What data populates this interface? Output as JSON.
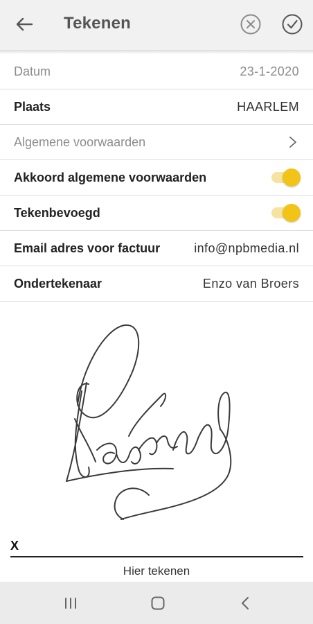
{
  "header": {
    "title": "Tekenen",
    "back_icon": "arrow-left-icon",
    "cancel_icon": "circle-x-icon",
    "confirm_icon": "circle-check-icon"
  },
  "form": {
    "rows": [
      {
        "label": "Datum",
        "value": "23-1-2020"
      },
      {
        "label": "Plaats",
        "value": "HAARLEM"
      },
      {
        "label": "Algemene voorwaarden",
        "value": ">"
      },
      {
        "label": "Akkoord algemene voorwaarden",
        "toggle_on": true
      },
      {
        "label": "Tekenbevoegd",
        "toggle_on": true
      },
      {
        "label": "Email adres voor factuur",
        "value": "info@npbmedia.nl"
      },
      {
        "label": "Ondertekenaar",
        "value": "Enzo van Broers"
      }
    ]
  },
  "signature": {
    "x_mark": "X",
    "hint": "Hier tekenen"
  },
  "colors": {
    "toggle_knob": "#f2c418",
    "toggle_track": "#f7e3a1",
    "appbar_bg": "#f1f1f1"
  },
  "navbar": {
    "recent_icon": "recent-apps-icon",
    "home_icon": "home-icon",
    "back_icon": "nav-back-icon"
  }
}
